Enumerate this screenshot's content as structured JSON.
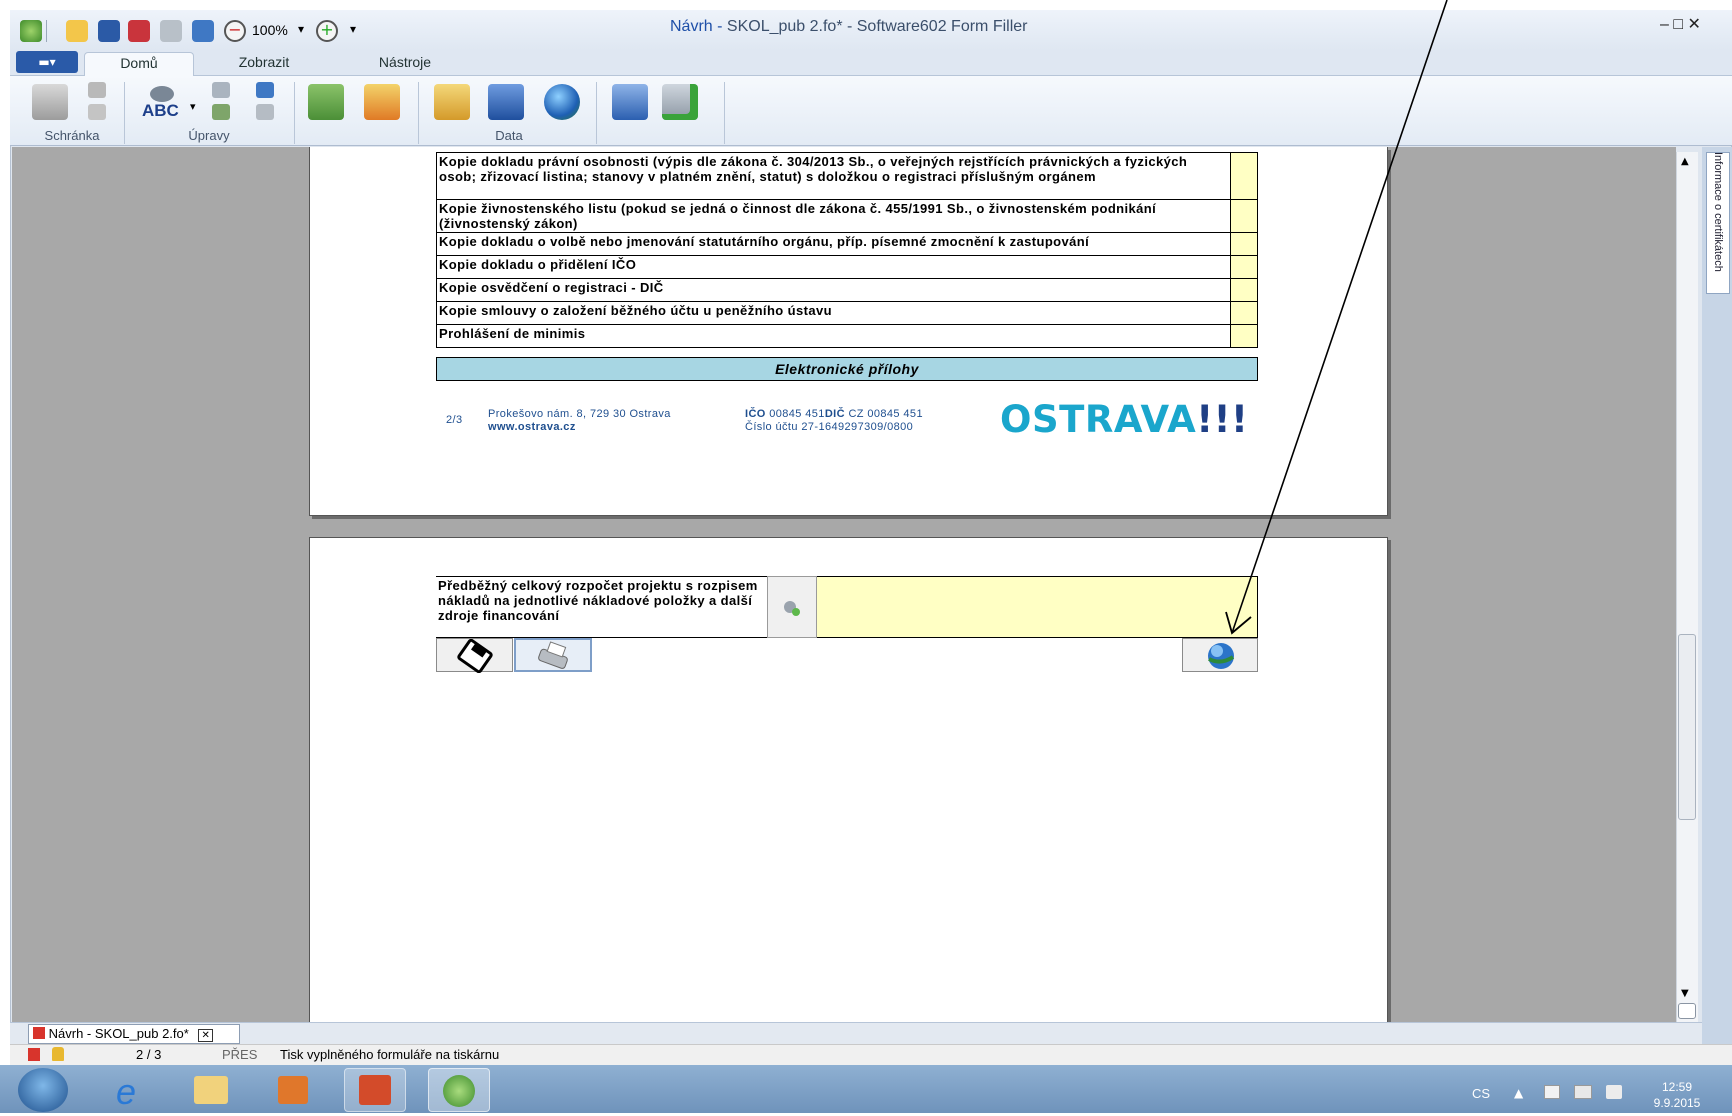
{
  "window": {
    "title_prefix": "Návrh -",
    "title_rest": " SKOL_pub 2.fo* - Software602 Form Filler",
    "zoom": "100%",
    "controls": "‒ □ ✕"
  },
  "ribbon": {
    "file_label": "▬▾",
    "tabs": [
      "Domů",
      "Zobrazit",
      "Nástroje"
    ],
    "groups": [
      "Schránka",
      "Úpravy",
      "Data"
    ],
    "abc_label": "ABC"
  },
  "form": {
    "requirements": [
      "Kopie dokladu právní osobnosti (výpis dle zákona č. 304/2013 Sb., o veřejných rejstřících právnických a fyzických osob; zřizovací listina; stanovy v platném znění, statut) s doložkou o registraci příslušným orgánem",
      "Kopie živnostenského listu (pokud se jedná o činnost dle zákona č. 455/1991 Sb., o živnostenském podnikání (živnostenský zákon)",
      "Kopie dokladu o volbě nebo jmenování statutárního orgánu, příp. písemné zmocnění k zastupování",
      "Kopie dokladu o přidělení IČO",
      "Kopie osvědčení o registraci - DIČ",
      "Kopie smlouvy o založení běžného účtu u peněžního ústavu",
      "Prohlášení de minimis"
    ],
    "electronic_header": "Elektronické přílohy",
    "footer": {
      "page": "2/3",
      "address": "Prokešovo nám. 8, 729 30 Ostrava",
      "web": "www.ostrava.cz",
      "ico_label": "IČO",
      "ico_value": " 00845 451",
      "dic_label": "DIČ",
      "dic_value": " CZ 00845 451",
      "account": "Číslo účtu 27-1649297309/0800"
    },
    "logo_main": "OSTRAVA",
    "logo_ex": "!!!",
    "budget_label": "Předběžný celkový rozpočet projektu s rozpisem nákladů na jednotlivé nákladové položky a další zdroje financování"
  },
  "side_panel": {
    "label": "Informace o certifikátech"
  },
  "doc_tab": {
    "label": "Návrh - SKOL_pub 2.fo*",
    "close": "✕"
  },
  "status": {
    "page": "2 / 3",
    "mode": "PŘES",
    "message": "Tisk vyplněného formuláře na tiskárnu"
  },
  "taskbar": {
    "lang": "CS",
    "time": "12:59",
    "date": "9.9.2015"
  },
  "colors": {
    "form_yellow": "#ffffc4",
    "header_blue": "#a7d6e3",
    "logo_cyan": "#1aa6cc"
  }
}
